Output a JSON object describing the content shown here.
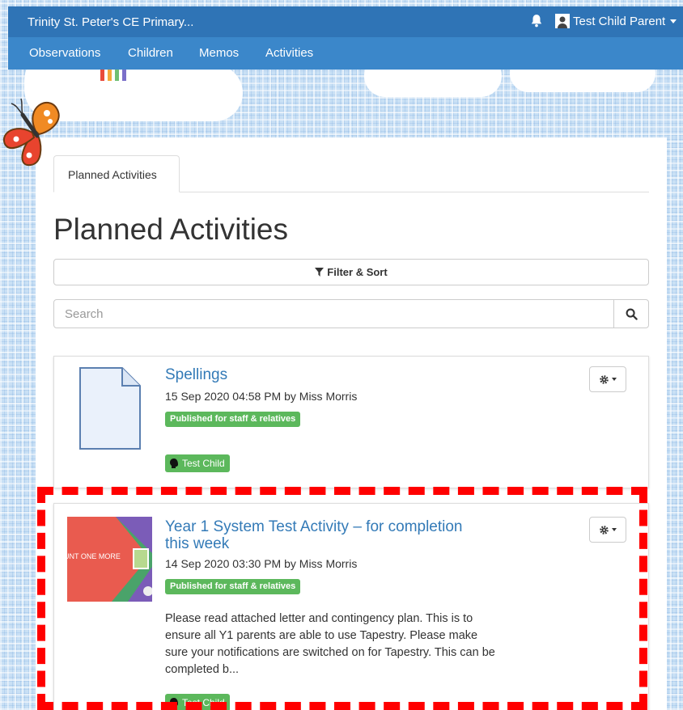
{
  "header": {
    "school_name": "Trinity St. Peter's CE Primary...",
    "user_name": "Test Child Parent"
  },
  "nav": {
    "items": [
      {
        "label": "Observations"
      },
      {
        "label": "Children"
      },
      {
        "label": "Memos"
      },
      {
        "label": "Activities"
      }
    ]
  },
  "main": {
    "tab_label": "Planned Activities",
    "page_title": "Planned Activities",
    "filter_label": "Filter & Sort",
    "search_placeholder": "Search"
  },
  "activities": [
    {
      "title": "Spellings",
      "meta": "15 Sep 2020 04:58 PM by Miss Morris",
      "badge": "Published for staff & relatives",
      "child": "Test Child",
      "thumbnail": "document-icon"
    },
    {
      "title": "Year 1 System Test Activity – for completion this week",
      "title_line1": "Year 1 System Test Activity – for completion",
      "title_line2": "this week",
      "meta": "14 Sep 2020 03:30 PM by Miss Morris",
      "badge": "Published for staff & relatives",
      "description": "Please read attached letter and contingency plan. This is to ensure all Y1 parents are able to use Tapestry. Please make sure your notifications are switched on for Tapestry. This can be completed b...",
      "desc_line1": "Please read attached letter and contingency plan. This is to",
      "desc_line2": "ensure all Y1 parents are able to use Tapestry. Please make",
      "desc_line3": "sure your notifications are switched on for Tapestry. This can be",
      "desc_line4": "completed b...",
      "child": "Test Child",
      "thumbnail_text": "UNT ONE MORE"
    }
  ],
  "colors": {
    "topbar": "#2f74b6",
    "navbar": "#3b87ca",
    "link": "#337ab7",
    "badge_green": "#5cb85c",
    "highlight": "#ff0000"
  }
}
